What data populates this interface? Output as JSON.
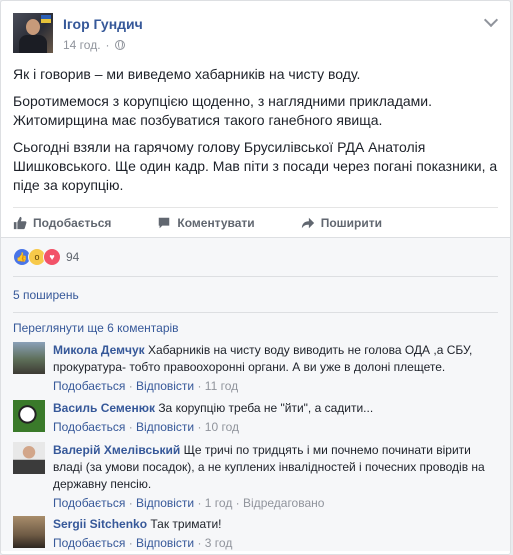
{
  "post": {
    "author": "Ігор Гундич",
    "time": "14 год.",
    "paragraphs": [
      "Як і говорив – ми виведемо хабарників на чисту воду.",
      "Боротимемося з корупцією щоденно, з наглядними прикладами. Житомирщина має позбуватися такого ганебного явища.",
      "Сьогодні взяли на гарячому голову Брусилівської РДА Анатолія Шишковського. Ще один кадр. Мав піти з посади через погані показники, а піде за корупцію."
    ]
  },
  "actions": {
    "like": "Подобається",
    "comment": "Коментувати",
    "share": "Поширити"
  },
  "reactions": {
    "count": "94"
  },
  "shares_text": "5 поширень",
  "more_comments": "Переглянути ще 6 коментарів",
  "comments": [
    {
      "name": "Микола Демчук",
      "text": "Хабарників на чисту воду виводить не голова ОДА ,а СБУ, прокуратура- тобто правоохоронні органи. А ви уже в долоні плещете.",
      "like": "Подобається",
      "reply": "Відповісти",
      "time": "11 год",
      "edited": ""
    },
    {
      "name": "Василь Семенюк",
      "text": "За корупцію треба не \"йти\", а садити...",
      "like": "Подобається",
      "reply": "Відповісти",
      "time": "10 год",
      "edited": ""
    },
    {
      "name": "Валерій Хмелівський",
      "text": "Ще тричі по тридцять і ми почнемо починати вірити владі (за умови посадок), а не куплених інвалідностей і почесних проводів на державну пенсію.",
      "like": "Подобається",
      "reply": "Відповісти",
      "time": "1 год",
      "edited": "Відредаговано"
    },
    {
      "name": "Sergii Sitchenko",
      "text": "Так тримати!",
      "like": "Подобається",
      "reply": "Відповісти",
      "time": "3 год",
      "edited": ""
    }
  ],
  "colors": {
    "link": "#365899",
    "meta": "#90949c",
    "background": "#f6f7f9"
  }
}
